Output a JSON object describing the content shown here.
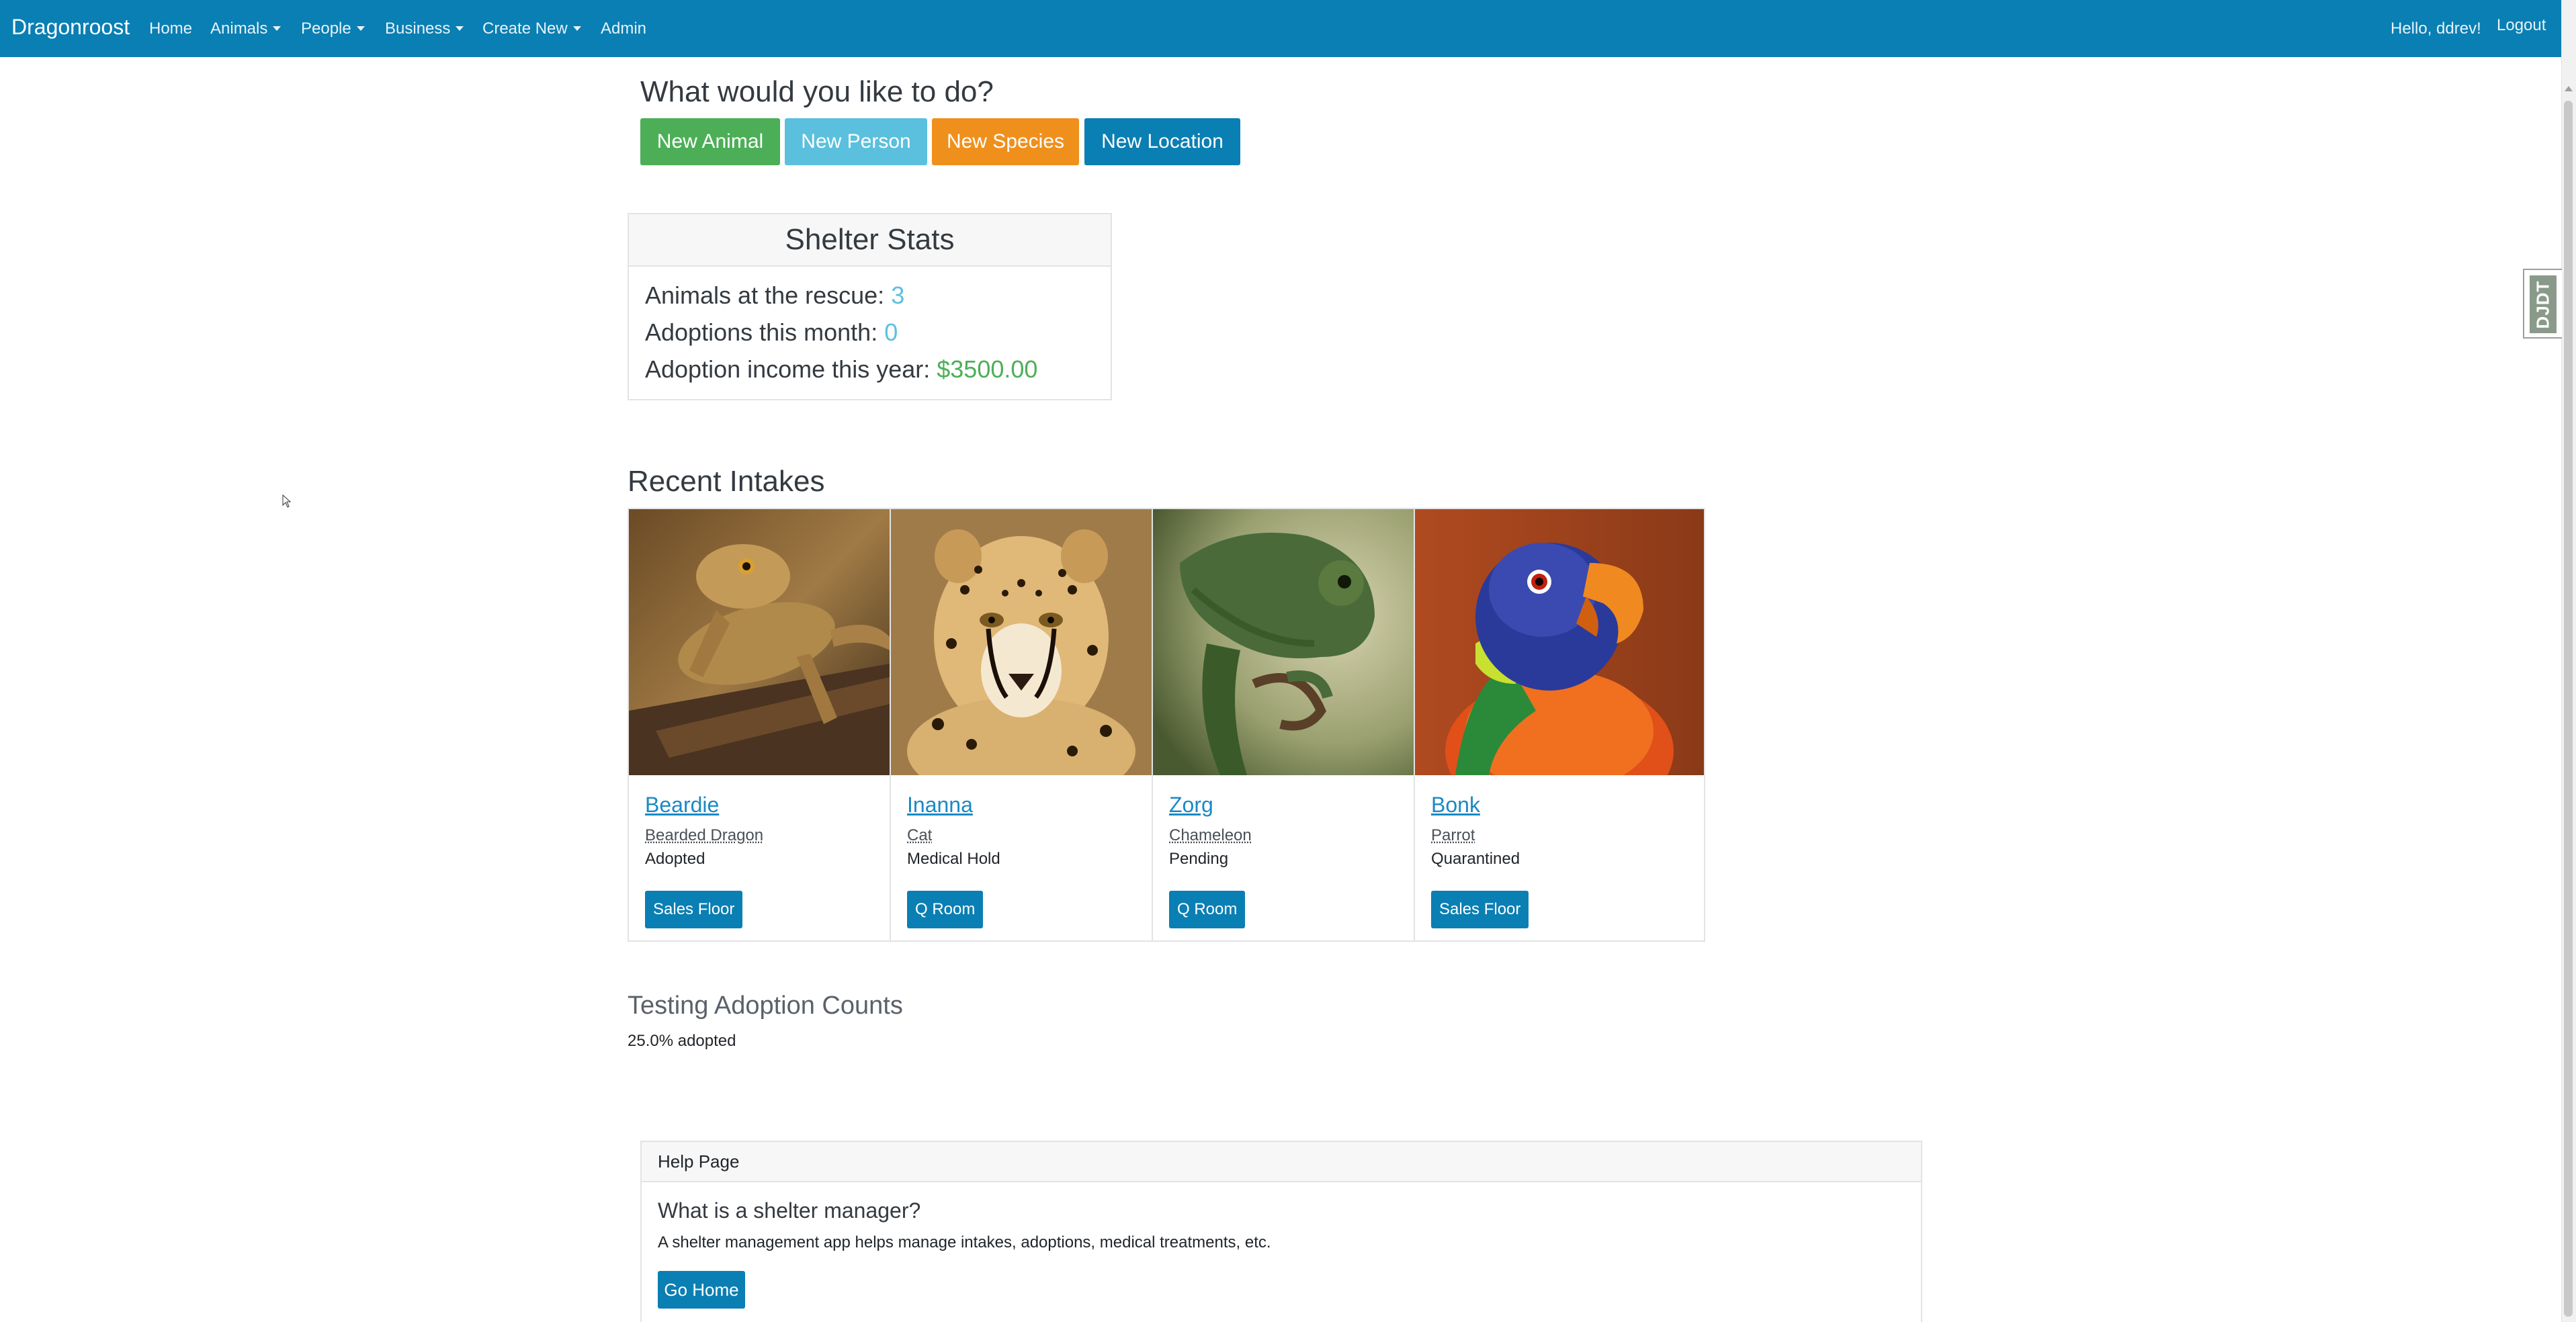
{
  "navbar": {
    "brand": "Dragonroost",
    "links": [
      "Home",
      "Animals",
      "People",
      "Business",
      "Create New",
      "Admin"
    ],
    "greeting": "Hello, ddrev!",
    "logout": "Logout"
  },
  "debug_toolbar": {
    "label": "DJDT"
  },
  "actions": {
    "heading": "What would you like to do?",
    "buttons": [
      "New Animal",
      "New Person",
      "New Species",
      "New Location"
    ]
  },
  "stats": {
    "title": "Shelter Stats",
    "animals_label": "Animals at the rescue:",
    "animals_value": "3",
    "adoptions_label": "Adoptions this month:",
    "adoptions_value": "0",
    "income_label": "Adoption income this year:",
    "income_value": "$3500.00"
  },
  "intakes": {
    "title": "Recent Intakes",
    "animals": [
      {
        "name": "Beardie",
        "species": "Bearded Dragon",
        "status": "Adopted",
        "location": "Sales Floor",
        "image": "bearded-dragon-photo"
      },
      {
        "name": "Inanna",
        "species": "Cat",
        "status": "Medical Hold",
        "location": "Q Room",
        "image": "cheetah-photo"
      },
      {
        "name": "Zorg",
        "species": "Chameleon",
        "status": "Pending",
        "location": "Q Room",
        "image": "chameleon-photo"
      },
      {
        "name": "Bonk",
        "species": "Parrot",
        "status": "Quarantined",
        "location": "Sales Floor",
        "image": "parrot-photo"
      }
    ]
  },
  "testing": {
    "title": "Testing Adoption Counts",
    "value": "25.0% adopted"
  },
  "help": {
    "header": "Help Page",
    "question": "What is a shelter manager?",
    "answer": "A shelter management app helps manage intakes, adoptions, medical treatments, etc.",
    "button": "Go Home"
  },
  "colors": {
    "navbar": "#0a7fb3",
    "success": "#4caf57",
    "info": "#5bc0de",
    "warning": "#f0901c",
    "primary": "#0a7fb3"
  }
}
